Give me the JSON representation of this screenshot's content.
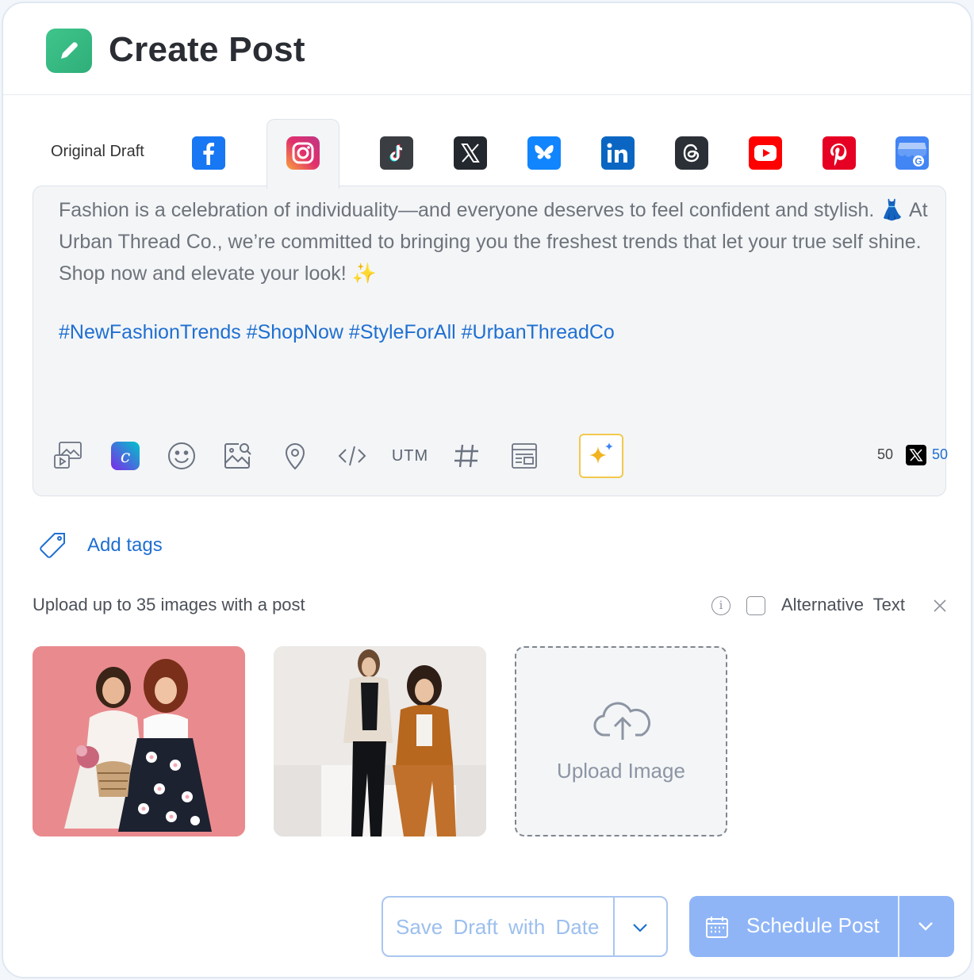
{
  "header": {
    "title": "Create Post",
    "logo_icon": "pencil-icon",
    "accent": "#3fc58c"
  },
  "tabs": {
    "draft_label": "Original Draft",
    "active": "instagram",
    "platforms": [
      {
        "id": "facebook",
        "icon": "facebook-icon",
        "color": "#1877f2"
      },
      {
        "id": "instagram",
        "icon": "instagram-icon",
        "color": "#e1306c"
      },
      {
        "id": "tiktok",
        "icon": "tiktok-icon",
        "color": "#3a3d42"
      },
      {
        "id": "x",
        "icon": "x-icon",
        "color": "#23272e"
      },
      {
        "id": "bluesky",
        "icon": "bluesky-icon",
        "color": "#1185fe"
      },
      {
        "id": "linkedin",
        "icon": "linkedin-icon",
        "color": "#0a66c2"
      },
      {
        "id": "threads",
        "icon": "threads-icon",
        "color": "#2b2f36"
      },
      {
        "id": "youtube",
        "icon": "youtube-icon",
        "color": "#ff0000"
      },
      {
        "id": "pinterest",
        "icon": "pinterest-icon",
        "color": "#e60023"
      },
      {
        "id": "google-business",
        "icon": "google-business-icon",
        "color": "#4285f4"
      }
    ]
  },
  "editor": {
    "text": "Fashion is a celebration of individuality—and everyone deserves to feel confident and stylish. 👗 At Urban Thread Co., we’re committed to bringing you the freshest trends that let your true self shine. Shop now and elevate your look! ✨",
    "hashtags": "#NewFashionTrends #ShopNow #StyleForAll #UrbanThreadCo",
    "toolbar": {
      "utm_label": "UTM",
      "icons": [
        "media-library-icon",
        "canva-icon",
        "emoji-icon",
        "image-search-icon",
        "location-icon",
        "code-icon",
        "utm-icon",
        "hashtag-icon",
        "template-icon",
        "ai-sparkle-icon"
      ]
    },
    "char_count": "50",
    "x_char_count": "50"
  },
  "tags": {
    "label": "Add tags",
    "icon": "tag-icon"
  },
  "media": {
    "note": "Upload up to 35 images with a post",
    "alt_text_label": "Alternative Text",
    "upload_label": "Upload Image",
    "images": [
      {
        "alt": "two smiling women in floral outfits against a pink background"
      },
      {
        "alt": "two women in suits posing on white blocks"
      }
    ]
  },
  "actions": {
    "save_draft_label": "Save Draft with Date",
    "schedule_label": "Schedule Post",
    "primary_color": "#8fb5f6"
  }
}
